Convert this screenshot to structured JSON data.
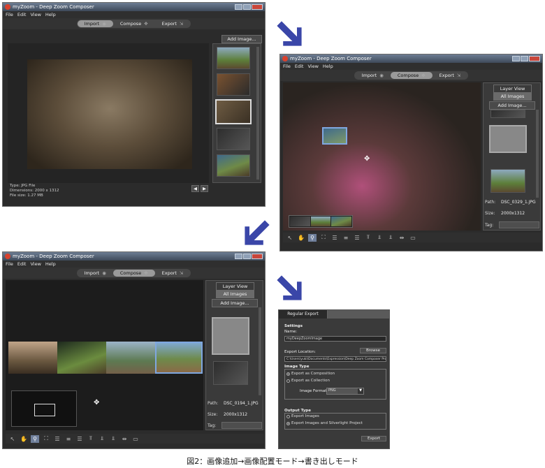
{
  "app": {
    "title": "myZoom - Deep Zoom Composer",
    "menu": [
      "File",
      "Edit",
      "View",
      "Help"
    ],
    "modes": [
      "Import",
      "Compose",
      "Export"
    ]
  },
  "import_window": {
    "add_image_label": "Add Image...",
    "file_type": "Type: JPG File",
    "dimensions": "Dimensions: 2000 x 1312",
    "file_size": "File size: 1.27 MB"
  },
  "compose_window": {
    "layer_view_label": "Layer View",
    "all_images_label": "All Images",
    "add_image_label": "Add Image...",
    "path_label": "Path:",
    "path_value": "DSC_0329_1.JPG",
    "size_label": "Size:",
    "size_value": "2000x1312",
    "tag_label": "Tag:"
  },
  "compose_window_2": {
    "layer_view_label": "Layer View",
    "all_images_label": "All Images",
    "add_image_label": "Add Image...",
    "path_label": "Path:",
    "path_value": "DSC_0194_1.JPG",
    "size_label": "Size:",
    "size_value": "2000x1312",
    "tag_label": "Tag:"
  },
  "export_dialog": {
    "tab_label": "Regular Export",
    "settings_label": "Settings",
    "name_label": "Name:",
    "name_value": "myDeepZoomImage",
    "export_location_label": "Export Location:",
    "browse_label": "Browse",
    "location_value": "C:\\Users\\yuki\\Documents\\Expression\\Deep Zoom Composer Pro",
    "image_type_label": "Image Type",
    "export_composition_label": "Export as Composition",
    "export_collection_label": "Export as Collection",
    "image_format_label": "Image Format",
    "image_format_value": "PNG",
    "output_type_label": "Output Type",
    "export_images_label": "Export Images",
    "export_images_sl_label": "Export Images and Silverlight Project",
    "export_button_label": "Export"
  },
  "caption": "図2：画像追加→画像配置モード→書き出しモード",
  "colors": {
    "arrow": "#3a46a8",
    "active_mode": "#9a9a9a",
    "selection": "#7fa7e0"
  }
}
